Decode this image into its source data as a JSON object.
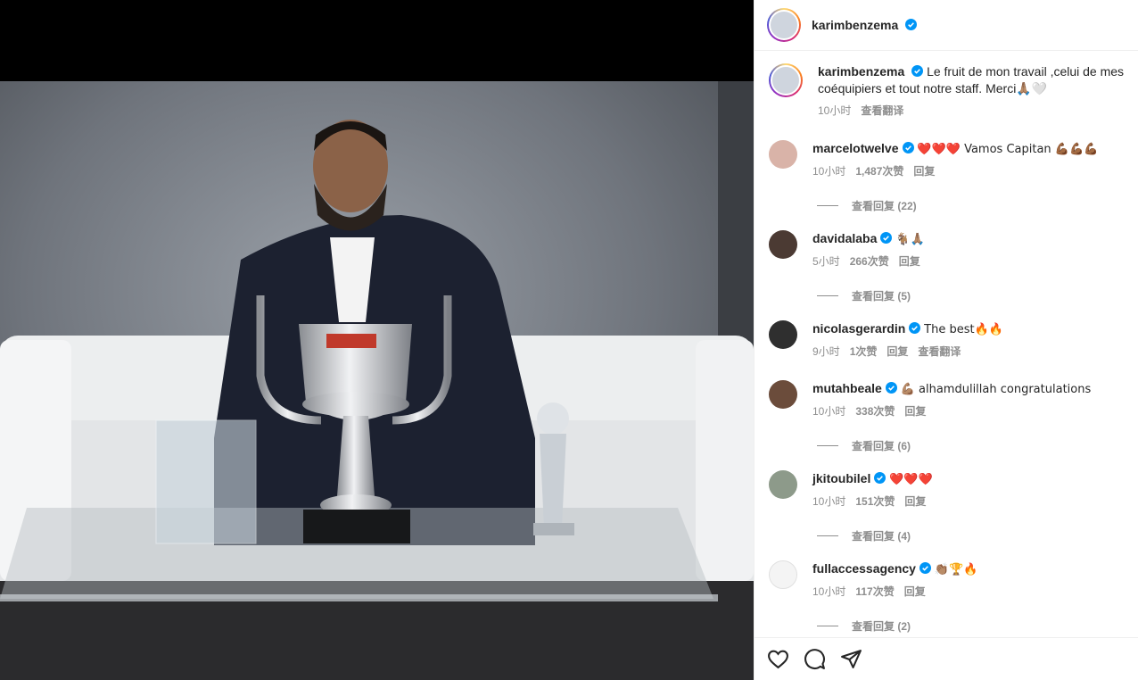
{
  "post": {
    "username": "karimbenzema",
    "caption": "Le fruit de mon travail ,celui de mes coéquipiers et tout notre staff. Merci🙏🏽🤍",
    "caption_time": "10小时",
    "caption_translate": "查看翻译"
  },
  "comments": [
    {
      "user": "marcelotwelve",
      "text": "❤️❤️❤️ Vamos Capitan 💪🏾💪🏾💪🏾",
      "time": "10小时",
      "likes": "1,487次赞",
      "reply": "回复",
      "view_replies": "查看回复 (22)"
    },
    {
      "user": "davidalaba",
      "text": "🐐🙏🏽",
      "time": "5小时",
      "likes": "266次赞",
      "reply": "回复",
      "view_replies": "查看回复 (5)"
    },
    {
      "user": "nicolasgerardin",
      "text": "The best🔥🔥",
      "time": "9小时",
      "likes": "1次赞",
      "reply": "回复",
      "translate": "查看翻译"
    },
    {
      "user": "mutahbeale",
      "text": "💪🏽 alhamdulillah congratulations",
      "time": "10小时",
      "likes": "338次赞",
      "reply": "回复",
      "view_replies": "查看回复 (6)"
    },
    {
      "user": "jkitoubilel",
      "text": "❤️❤️❤️",
      "time": "10小时",
      "likes": "151次赞",
      "reply": "回复",
      "view_replies": "查看回复 (4)"
    },
    {
      "user": "fullaccessagency",
      "text": "👏🏽🏆🔥",
      "time": "10小时",
      "likes": "117次赞",
      "reply": "回复",
      "view_replies": "查看回复 (2)"
    }
  ],
  "icons": {
    "like": "heart-icon",
    "comment": "comment-icon",
    "share": "share-icon",
    "verified": "verified-badge-icon"
  },
  "colors": {
    "verified": "#0095f6",
    "muted": "#8e8e8e"
  }
}
